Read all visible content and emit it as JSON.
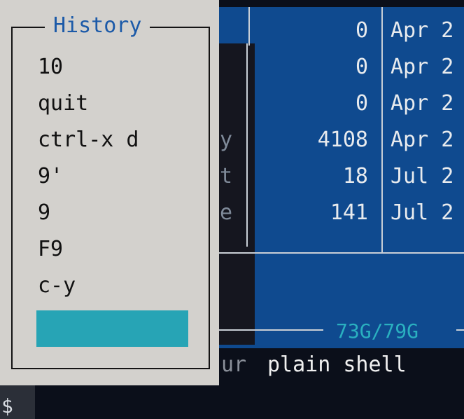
{
  "history": {
    "title": "History",
    "items": [
      "10",
      "quit",
      "ctrl-x d",
      "9'",
      "9",
      "F9",
      "c-y",
      ""
    ],
    "selected_index": 7
  },
  "file_panel": {
    "rows": [
      {
        "trunc": "",
        "size": "0",
        "date": "Apr 2"
      },
      {
        "trunc": "",
        "size": "0",
        "date": "Apr 2"
      },
      {
        "trunc": "",
        "size": "0",
        "date": "Apr 2"
      },
      {
        "trunc": "y",
        "size": "4108",
        "date": "Apr 2"
      },
      {
        "trunc": "t",
        "size": "18",
        "date": "Jul 2"
      },
      {
        "trunc": "e",
        "size": "141",
        "date": "Jul 2"
      }
    ],
    "disk_usage": "73G/79G"
  },
  "hint": {
    "dim": "ur",
    "text": "plain shell"
  },
  "prompt": "$",
  "colors": {
    "panel_bg": "#0f4a8f",
    "dialog_bg": "#d3d1cd",
    "selection": "#27a4b5",
    "title": "#1c5aa8",
    "accent": "#2ab0c0"
  }
}
